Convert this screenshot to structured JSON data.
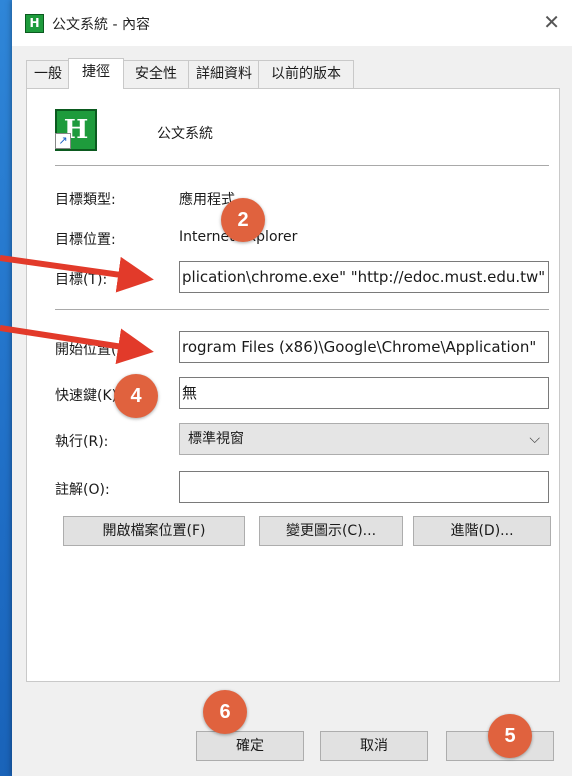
{
  "window": {
    "title": "公文系統 - 內容",
    "close_glyph": "✕",
    "app_icon_letter": "H"
  },
  "tabs": [
    {
      "label": "一般",
      "active": false
    },
    {
      "label": "捷徑",
      "active": true
    },
    {
      "label": "安全性",
      "active": false
    },
    {
      "label": "詳細資料",
      "active": false
    },
    {
      "label": "以前的版本",
      "active": false
    }
  ],
  "shortcut": {
    "name": "公文系統",
    "fields": {
      "target_type_label": "目標類型:",
      "target_type_value": "應用程式",
      "target_location_label": "目標位置:",
      "target_location_value": "Internet Explorer",
      "target_label": "目標(T):",
      "target_value": "plication\\chrome.exe\" \"http://edoc.must.edu.tw\"",
      "start_in_label": "開始位置(S):",
      "start_in_value": "rogram Files (x86)\\Google\\Chrome\\Application\"",
      "hotkey_label": "快速鍵(K):",
      "hotkey_value": "無",
      "run_label": "執行(R):",
      "run_value": "標準視窗",
      "comment_label": "註解(O):",
      "comment_value": ""
    },
    "buttons": {
      "open_location": "開啟檔案位置(F)",
      "change_icon": "變更圖示(C)...",
      "advanced": "進階(D)..."
    }
  },
  "footer": {
    "ok": "確定",
    "cancel": "取消",
    "apply": "套"
  },
  "annotations": {
    "m2": "2",
    "m4": "4",
    "m5": "5",
    "m6": "6"
  },
  "colors": {
    "marker": "#e0623e",
    "arrow": "#e23a2a",
    "desktop": "#1e6cc4"
  }
}
